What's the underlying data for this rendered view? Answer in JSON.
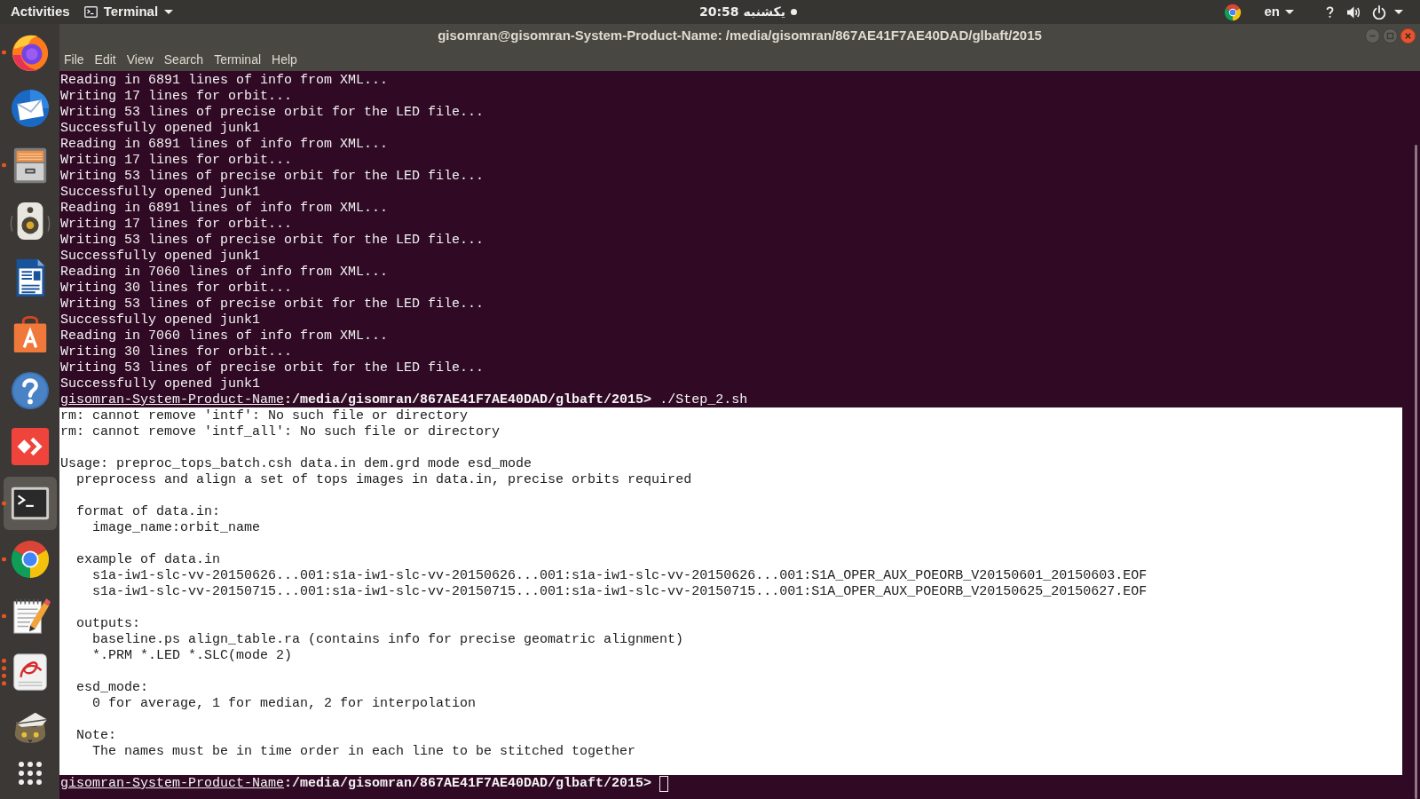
{
  "top_bar": {
    "activities": "Activities",
    "app_menu": "Terminal",
    "clock": "20:58 یکشنبه",
    "notification": true,
    "language": "en"
  },
  "dock": {
    "items": [
      {
        "kind": "browser",
        "selected": false,
        "running": true,
        "several_windows": false
      },
      {
        "kind": "mail",
        "selected": false,
        "running": false
      },
      {
        "kind": "files",
        "selected": false,
        "running": true,
        "several_windows": false
      },
      {
        "kind": "music",
        "selected": false,
        "running": false
      },
      {
        "kind": "writer",
        "selected": false,
        "running": false
      },
      {
        "kind": "store",
        "selected": false,
        "running": false
      },
      {
        "kind": "help",
        "selected": false,
        "running": false
      },
      {
        "kind": "remote",
        "selected": false,
        "running": false
      },
      {
        "kind": "terminal",
        "selected": true,
        "running": true,
        "several_windows": false
      },
      {
        "kind": "web",
        "selected": false,
        "running": true,
        "several_windows": false
      },
      {
        "kind": "editor",
        "selected": false,
        "running": true,
        "several_windows": false
      },
      {
        "kind": "reader",
        "selected": false,
        "running": true,
        "several_windows": true
      },
      {
        "kind": "cat",
        "selected": false,
        "running": false
      }
    ]
  },
  "window": {
    "title": "gisomran@gisomran-System-Product-Name: /media/gisomran/867AE41F7AE40DAD/glbaft/2015",
    "menu": [
      "File",
      "Edit",
      "View",
      "Search",
      "Terminal",
      "Help"
    ]
  },
  "terminal": {
    "lines": [
      {
        "kind": "output",
        "text": "Reading in 6891 lines of info from XML...",
        "selected": false
      },
      {
        "kind": "output",
        "text": "Writing 17 lines for orbit...",
        "selected": false
      },
      {
        "kind": "output",
        "text": "Writing 53 lines of precise orbit for the LED file...",
        "selected": false
      },
      {
        "kind": "output",
        "text": "Successfully opened junk1",
        "selected": false
      },
      {
        "kind": "output",
        "text": "Reading in 6891 lines of info from XML...",
        "selected": false
      },
      {
        "kind": "output",
        "text": "Writing 17 lines for orbit...",
        "selected": false
      },
      {
        "kind": "output",
        "text": "Writing 53 lines of precise orbit for the LED file...",
        "selected": false
      },
      {
        "kind": "output",
        "text": "Successfully opened junk1",
        "selected": false
      },
      {
        "kind": "output",
        "text": "Reading in 6891 lines of info from XML...",
        "selected": false
      },
      {
        "kind": "output",
        "text": "Writing 17 lines for orbit...",
        "selected": false
      },
      {
        "kind": "output",
        "text": "Writing 53 lines of precise orbit for the LED file...",
        "selected": false
      },
      {
        "kind": "output",
        "text": "Successfully opened junk1",
        "selected": false
      },
      {
        "kind": "output",
        "text": "Reading in 7060 lines of info from XML...",
        "selected": false
      },
      {
        "kind": "output",
        "text": "Writing 30 lines for orbit...",
        "selected": false
      },
      {
        "kind": "output",
        "text": "Writing 53 lines of precise orbit for the LED file...",
        "selected": false
      },
      {
        "kind": "output",
        "text": "Successfully opened junk1",
        "selected": false
      },
      {
        "kind": "output",
        "text": "Reading in 7060 lines of info from XML...",
        "selected": false
      },
      {
        "kind": "output",
        "text": "Writing 30 lines for orbit...",
        "selected": false
      },
      {
        "kind": "output",
        "text": "Writing 53 lines of precise orbit for the LED file...",
        "selected": false
      },
      {
        "kind": "output",
        "text": "Successfully opened junk1",
        "selected": false
      },
      {
        "kind": "prompt",
        "host": "gisomran-System-Product-Name",
        "path": ":/media/gisomran/867AE41F7AE40DAD/glbaft/2015>",
        "command": "./Step_2.sh",
        "cursor": false,
        "selected": false
      },
      {
        "kind": "output",
        "text": "rm: cannot remove 'intf': No such file or directory",
        "selected": true
      },
      {
        "kind": "output",
        "text": "rm: cannot remove 'intf_all': No such file or directory",
        "selected": true
      },
      {
        "kind": "blank",
        "selected": true
      },
      {
        "kind": "output",
        "text": "Usage: preproc_tops_batch.csh data.in dem.grd mode esd_mode",
        "selected": true
      },
      {
        "kind": "output",
        "text": "  preprocess and align a set of tops images in data.in, precise orbits required",
        "selected": true
      },
      {
        "kind": "blank",
        "selected": true
      },
      {
        "kind": "output",
        "text": "  format of data.in:",
        "selected": true
      },
      {
        "kind": "output",
        "text": "    image_name:orbit_name",
        "selected": true
      },
      {
        "kind": "blank",
        "selected": true
      },
      {
        "kind": "output",
        "text": "  example of data.in",
        "selected": true
      },
      {
        "kind": "output",
        "text": "    s1a-iw1-slc-vv-20150626...001:s1a-iw1-slc-vv-20150626...001:s1a-iw1-slc-vv-20150626...001:S1A_OPER_AUX_POEORB_V20150601_20150603.EOF",
        "selected": true
      },
      {
        "kind": "output",
        "text": "    s1a-iw1-slc-vv-20150715...001:s1a-iw1-slc-vv-20150715...001:s1a-iw1-slc-vv-20150715...001:S1A_OPER_AUX_POEORB_V20150625_20150627.EOF",
        "selected": true
      },
      {
        "kind": "blank",
        "selected": true
      },
      {
        "kind": "output",
        "text": "  outputs:",
        "selected": true
      },
      {
        "kind": "output",
        "text": "    baseline.ps align_table.ra (contains info for precise geomatric alignment)",
        "selected": true
      },
      {
        "kind": "output",
        "text": "    *.PRM *.LED *.SLC(mode 2)",
        "selected": true
      },
      {
        "kind": "blank",
        "selected": true
      },
      {
        "kind": "output",
        "text": "  esd_mode:",
        "selected": true
      },
      {
        "kind": "output",
        "text": "    0 for average, 1 for median, 2 for interpolation",
        "selected": true
      },
      {
        "kind": "blank",
        "selected": true
      },
      {
        "kind": "output",
        "text": "  Note:",
        "selected": true
      },
      {
        "kind": "output",
        "text": "    The names must be in time order in each line to be stitched together",
        "selected": true
      },
      {
        "kind": "blank",
        "selected": true
      },
      {
        "kind": "prompt",
        "host": "gisomran-System-Product-Name",
        "path": ":/media/gisomran/867AE41F7AE40DAD/glbaft/2015>",
        "cursor": true,
        "selected": false
      }
    ]
  }
}
